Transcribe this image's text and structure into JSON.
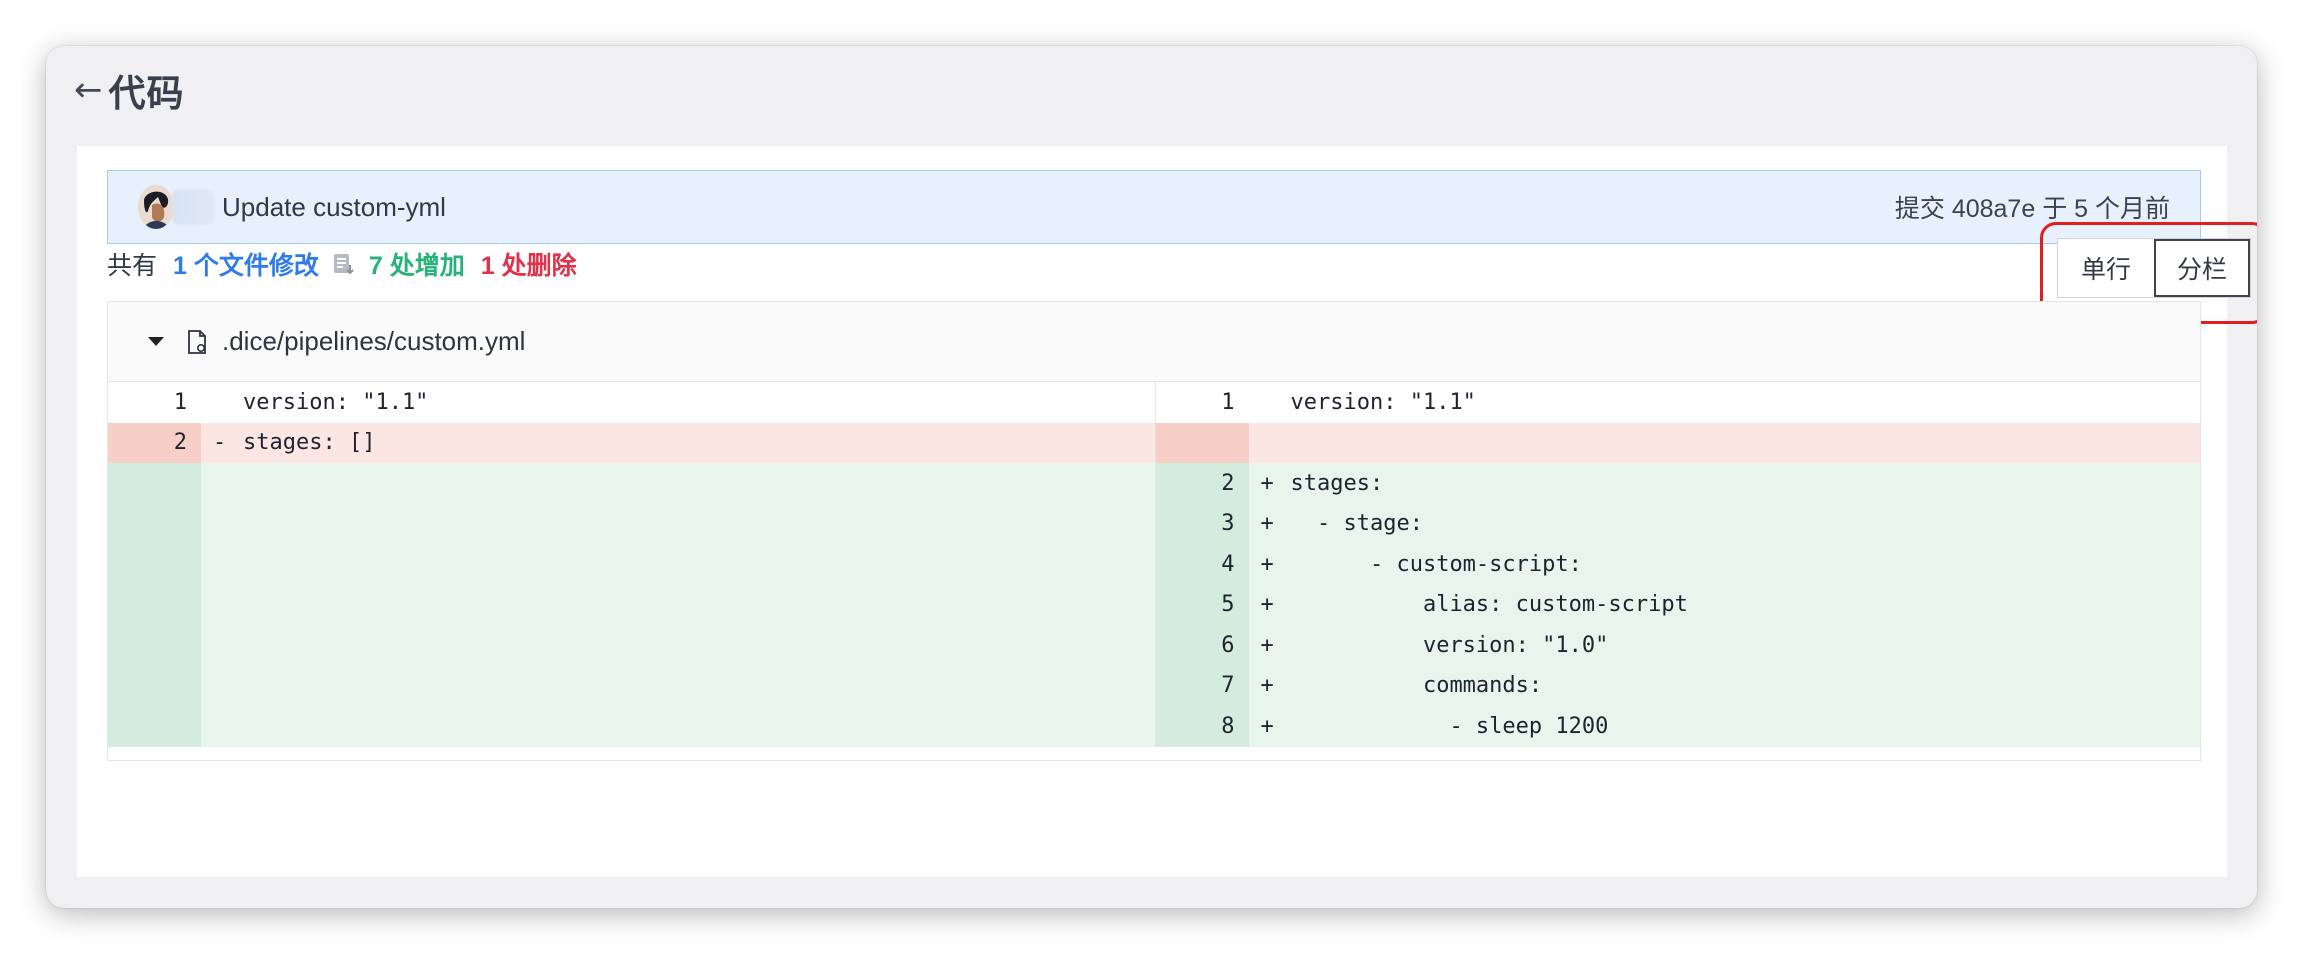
{
  "header": {
    "back_label": "←",
    "title": "代码"
  },
  "commit": {
    "message": "Update custom-yml",
    "meta": "提交 408a7e 于  5 个月前"
  },
  "summary": {
    "prefix": "共有",
    "files": "1 个文件修改",
    "additions": "7 处增加",
    "deletions": "1 处删除"
  },
  "view_toggle": {
    "single": "单行",
    "split": "分栏",
    "active": "split"
  },
  "file": {
    "path": ".dice/pipelines/custom.yml"
  },
  "diff": {
    "left": [
      {
        "ln": "1",
        "mark": "",
        "code": "version: \"1.1\"",
        "type": "ctx"
      },
      {
        "ln": "2",
        "mark": "-",
        "code": "stages: []",
        "type": "del"
      },
      {
        "ln": "",
        "mark": "",
        "code": "",
        "type": "empty-add"
      },
      {
        "ln": "",
        "mark": "",
        "code": "",
        "type": "empty-add"
      },
      {
        "ln": "",
        "mark": "",
        "code": "",
        "type": "empty-add"
      },
      {
        "ln": "",
        "mark": "",
        "code": "",
        "type": "empty-add"
      },
      {
        "ln": "",
        "mark": "",
        "code": "",
        "type": "empty-add"
      },
      {
        "ln": "",
        "mark": "",
        "code": "",
        "type": "empty-add"
      },
      {
        "ln": "",
        "mark": "",
        "code": "",
        "type": "empty-add"
      }
    ],
    "right": [
      {
        "ln": "1",
        "mark": "",
        "code": "version: \"1.1\"",
        "type": "ctx"
      },
      {
        "ln": "",
        "mark": "",
        "code": "",
        "type": "empty-del"
      },
      {
        "ln": "2",
        "mark": "+",
        "code": "stages:",
        "type": "add"
      },
      {
        "ln": "3",
        "mark": "+",
        "code": "  - stage:",
        "type": "add"
      },
      {
        "ln": "4",
        "mark": "+",
        "code": "      - custom-script:",
        "type": "add"
      },
      {
        "ln": "5",
        "mark": "+",
        "code": "          alias: custom-script",
        "type": "add"
      },
      {
        "ln": "6",
        "mark": "+",
        "code": "          version: \"1.0\"",
        "type": "add"
      },
      {
        "ln": "7",
        "mark": "+",
        "code": "          commands:",
        "type": "add"
      },
      {
        "ln": "8",
        "mark": "+",
        "code": "            - sleep 1200",
        "type": "add"
      }
    ]
  },
  "colors": {
    "accent_blue": "#2e7ce8",
    "add_green": "#26b37a",
    "del_red": "#e0334b",
    "highlight_red": "#e02020"
  }
}
